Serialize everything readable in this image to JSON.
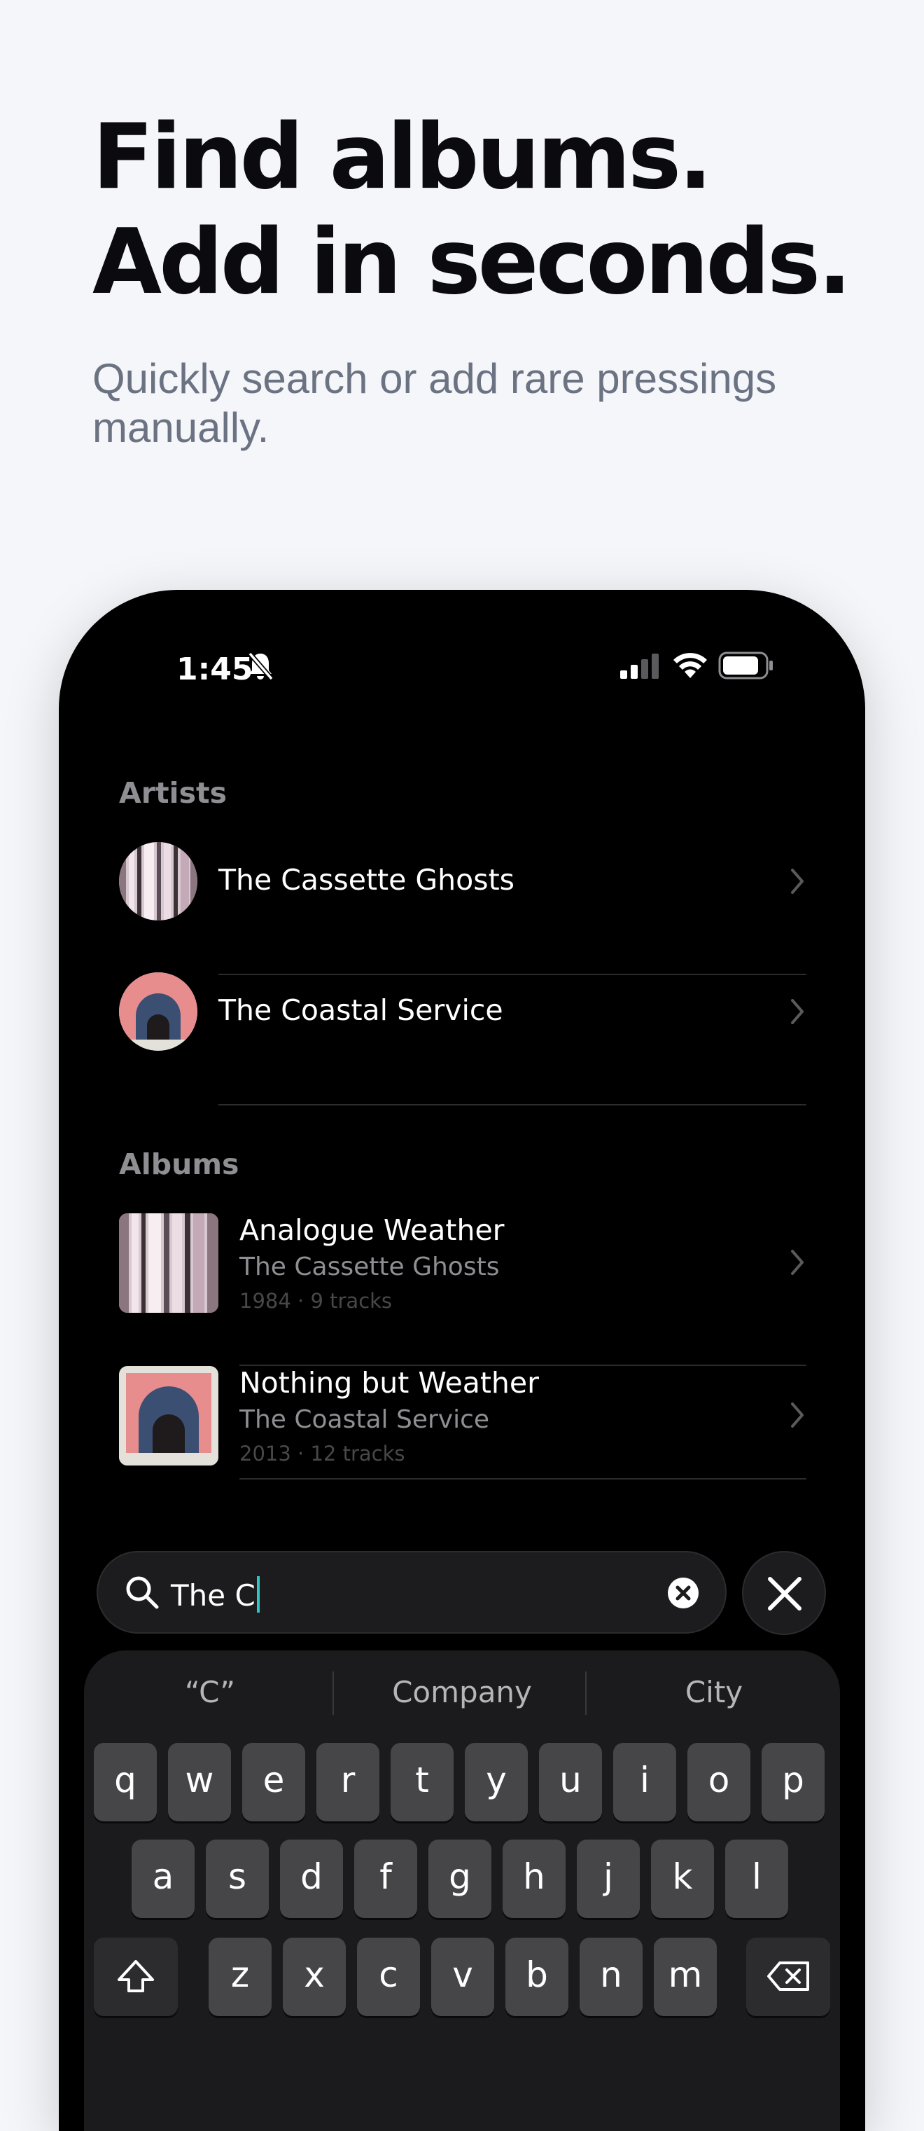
{
  "headline": {
    "line1": "Find albums.",
    "line2": "Add in seconds."
  },
  "subtitle": "Quickly search or add rare pressings manually.",
  "status_bar": {
    "time": "1:45",
    "bell_icon": "bell-slash-icon",
    "signal_icon": "cellular-signal-icon",
    "wifi_icon": "wifi-icon",
    "battery_icon": "battery-icon"
  },
  "artists": {
    "label": "Artists",
    "items": [
      {
        "name": "The Cassette Ghosts"
      },
      {
        "name": "The Coastal Service"
      }
    ]
  },
  "albums": {
    "label": "Albums",
    "items": [
      {
        "title": "Analogue Weather",
        "artist": "The Cassette Ghosts",
        "meta": "1984 · 9 tracks"
      },
      {
        "title": "Nothing but Weather",
        "artist": "The Coastal Service",
        "meta": "2013 · 12 tracks"
      }
    ]
  },
  "search": {
    "value": "The C",
    "search_icon": "magnifier-icon",
    "clear_icon": "clear-circle-icon",
    "close_icon": "close-icon"
  },
  "keyboard": {
    "suggestions": [
      "“C”",
      "Company",
      "City"
    ],
    "row1": [
      "q",
      "w",
      "e",
      "r",
      "t",
      "y",
      "u",
      "i",
      "o",
      "p"
    ],
    "row2": [
      "a",
      "s",
      "d",
      "f",
      "g",
      "h",
      "j",
      "k",
      "l"
    ],
    "row3": [
      "z",
      "x",
      "c",
      "v",
      "b",
      "n",
      "m"
    ],
    "shift_icon": "shift-icon",
    "delete_icon": "backspace-icon"
  },
  "colors": {
    "background": "#f5f6fa",
    "headline": "#0b0b0f",
    "subtitle": "#6b7282",
    "accent_caret": "#31c6c6"
  }
}
